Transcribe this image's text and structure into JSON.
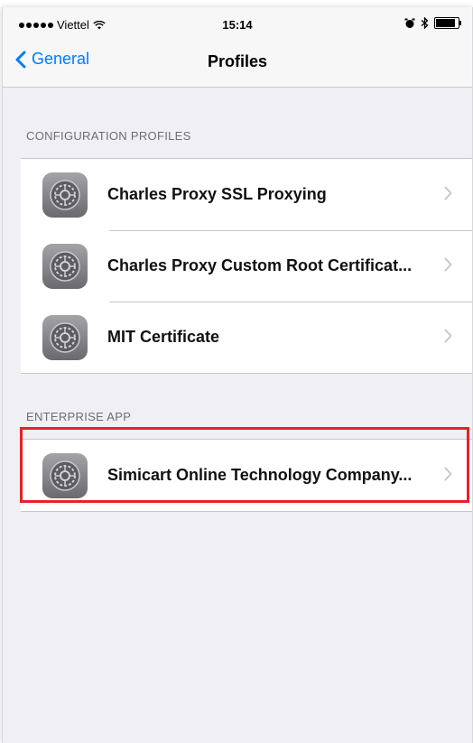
{
  "status_bar": {
    "carrier": "Viettel",
    "time": "15:14"
  },
  "nav": {
    "back_label": "General",
    "title": "Profiles"
  },
  "sections": [
    {
      "header": "CONFIGURATION PROFILES",
      "items": [
        {
          "label": "Charles Proxy SSL Proxying",
          "icon": "settings-gear-icon"
        },
        {
          "label": "Charles Proxy Custom Root Certificat...",
          "icon": "settings-gear-icon"
        },
        {
          "label": "MIT Certificate",
          "icon": "settings-gear-icon"
        }
      ]
    },
    {
      "header": "ENTERPRISE APP",
      "items": [
        {
          "label": "Simicart Online Technology Company...",
          "icon": "settings-gear-icon"
        }
      ]
    }
  ],
  "colors": {
    "accent": "#007aff",
    "background": "#efeff4",
    "highlight": "#e8202a"
  }
}
